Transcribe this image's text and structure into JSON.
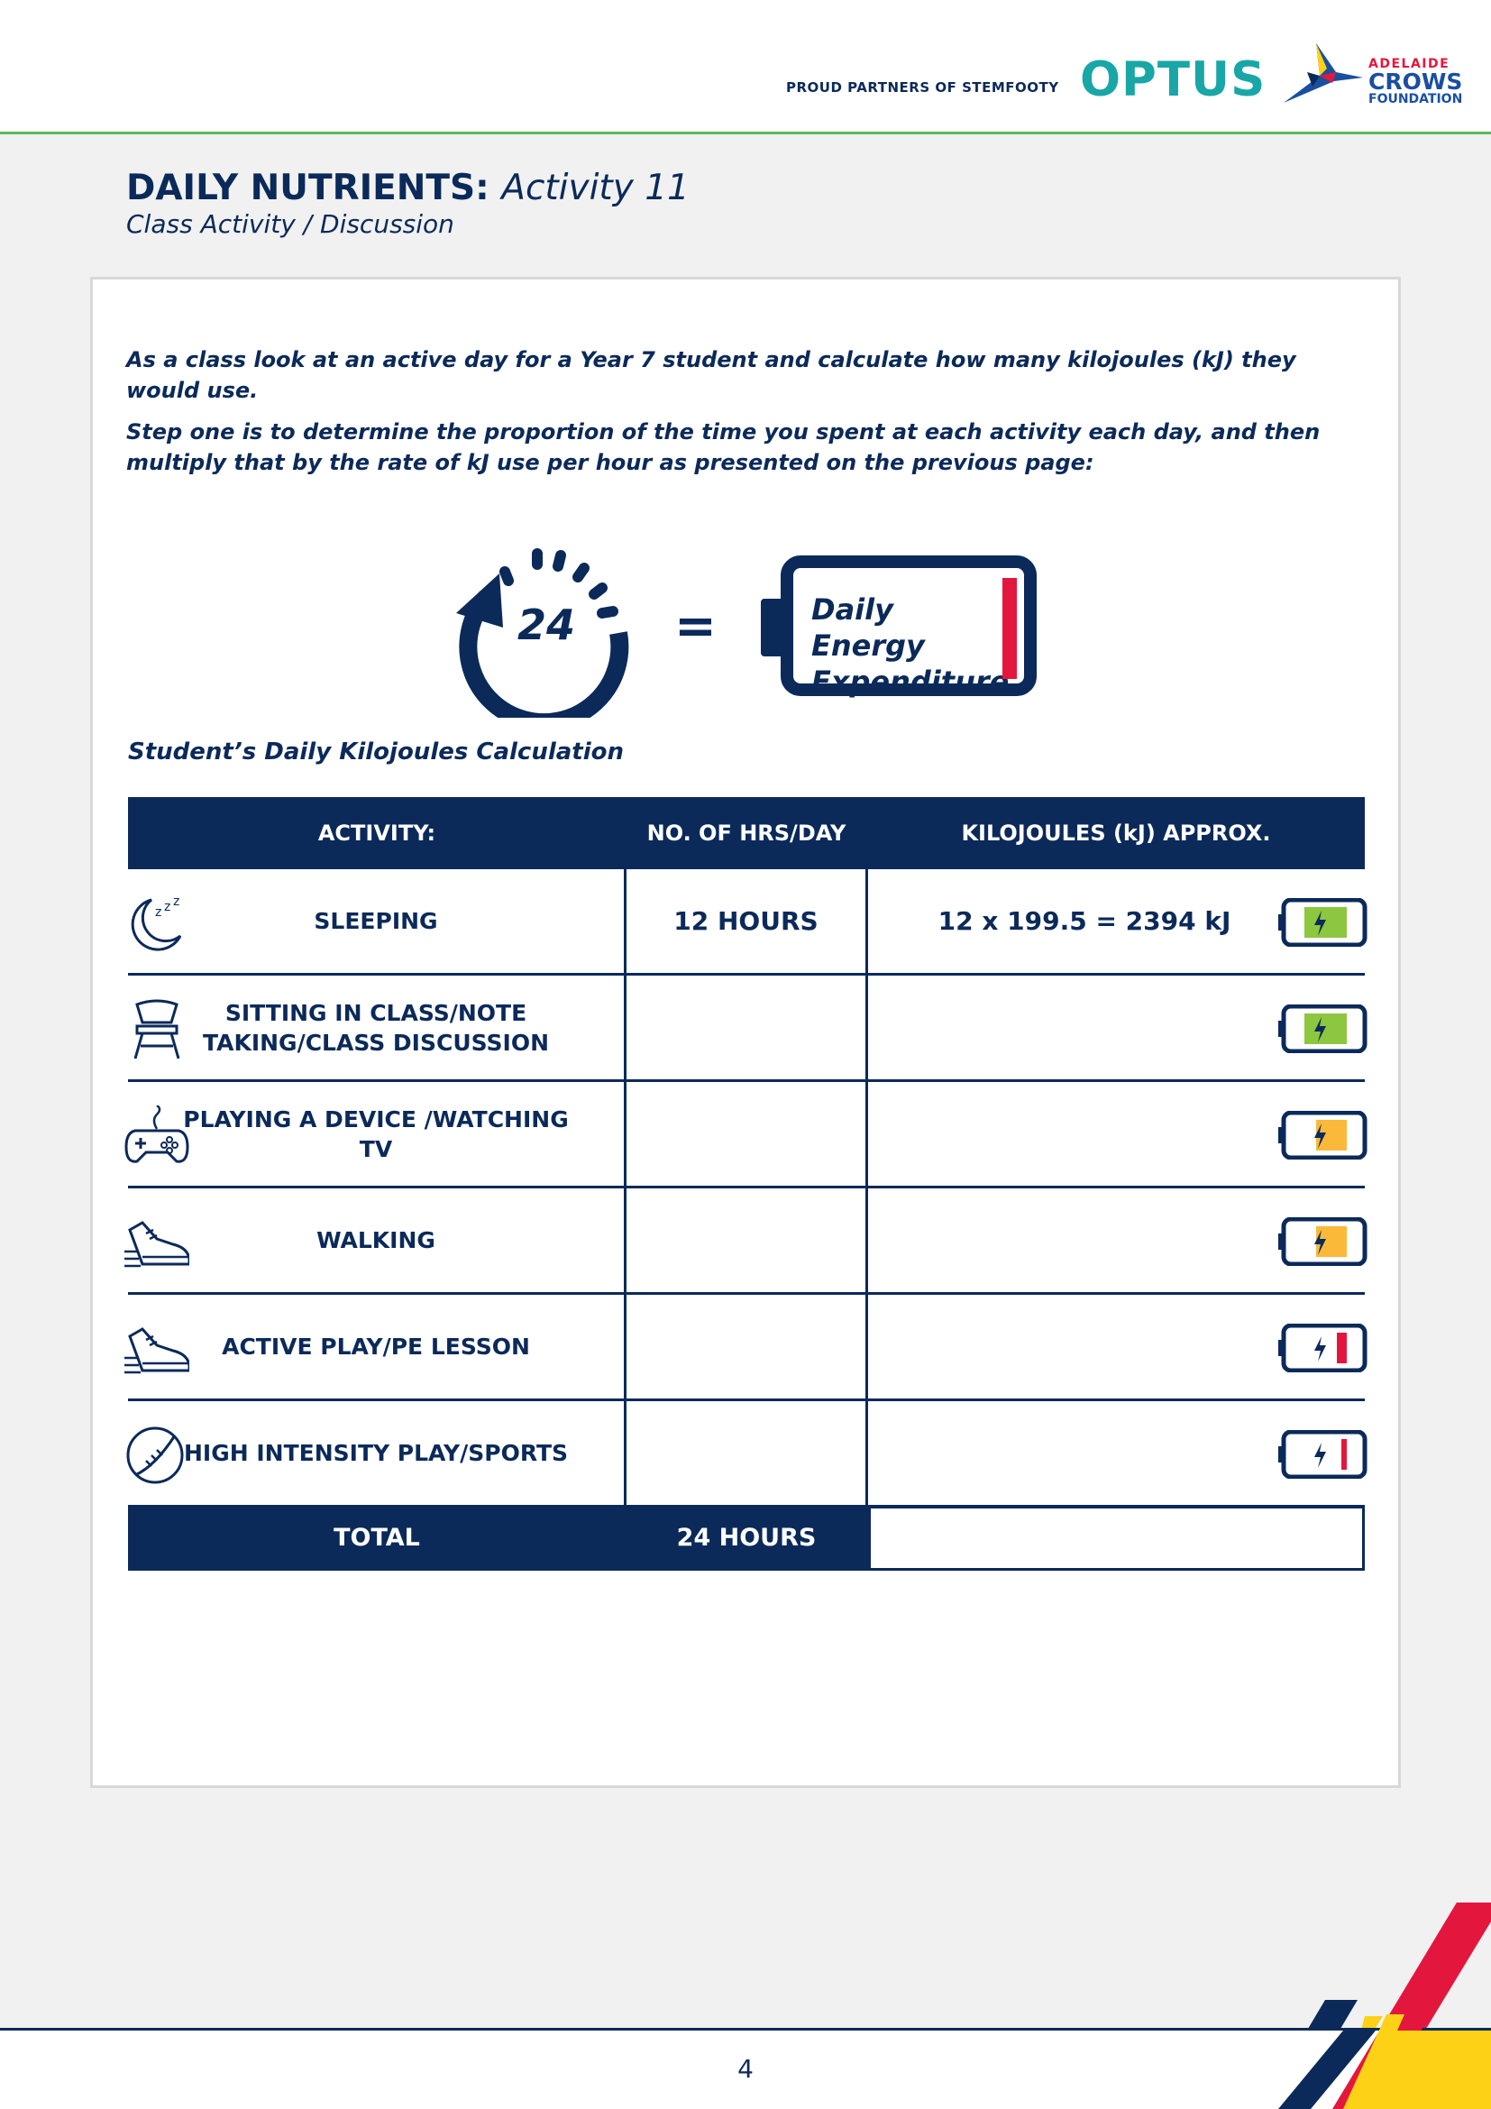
{
  "header": {
    "partner_text": "PROUD PARTNERS OF STEMFOOTY",
    "optus_logo": "OPTUS",
    "crows_logo": {
      "line1": "ADELAIDE",
      "line2": "CROWS",
      "line3": "FOUNDATION"
    }
  },
  "page": {
    "title_bold": "DAILY NUTRIENTS:",
    "title_italic": "Activity 11",
    "subtitle": "Class Activity / Discussion"
  },
  "intro": {
    "p1": "As a class look at an active day for a Year 7 student and calculate how many kilojoules (kJ) they would use.",
    "p2": "Step one is to determine the proportion of the time you spent at each activity each day, and then multiply that by the rate of kJ use per hour as presented on the previous page:"
  },
  "equation": {
    "clock_number": "24",
    "equals": "=",
    "battery_line1": "Daily Energy",
    "battery_line2": "Expenditure"
  },
  "table": {
    "caption": "Student’s Daily Kilojoules Calculation",
    "headers": {
      "activity": "ACTIVITY:",
      "hours": "NO. OF HRS/DAY",
      "kj": "KILOJOULES (kJ) APPROX."
    },
    "rows": [
      {
        "icon": "sleep-icon",
        "label": "SLEEPING",
        "hours": "12 HOURS",
        "kj": "12 x 199.5 = 2394 kJ",
        "battery_level": 0.75,
        "battery_color": "#8dc63f"
      },
      {
        "icon": "chair-icon",
        "label": "SITTING IN CLASS/NOTE TAKING/CLASS DISCUSSION",
        "hours": "",
        "kj": "",
        "battery_level": 0.75,
        "battery_color": "#8dc63f"
      },
      {
        "icon": "gamepad-icon",
        "label": "PLAYING A DEVICE /WATCHING TV",
        "hours": "",
        "kj": "",
        "battery_level": 0.55,
        "battery_color": "#fbb93a"
      },
      {
        "icon": "sneaker-icon",
        "label": "WALKING",
        "hours": "",
        "kj": "",
        "battery_level": 0.55,
        "battery_color": "#fbb93a"
      },
      {
        "icon": "sneaker-icon",
        "label": "ACTIVE PLAY/PE LESSON",
        "hours": "",
        "kj": "",
        "battery_level": 0.18,
        "battery_color": "#e3173e"
      },
      {
        "icon": "football-icon",
        "label": "HIGH INTENSITY PLAY/SPORTS",
        "hours": "",
        "kj": "",
        "battery_level": 0.1,
        "battery_color": "#e3173e"
      }
    ],
    "total": {
      "label": "TOTAL",
      "hours": "24 HOURS",
      "kj": ""
    }
  },
  "footer": {
    "page_number": "4"
  },
  "colors": {
    "navy": "#0b2a5a",
    "red": "#e3173e",
    "yellow": "#fcd116",
    "teal": "#19a6a6",
    "green": "#8dc63f",
    "orange": "#fbb93a"
  }
}
